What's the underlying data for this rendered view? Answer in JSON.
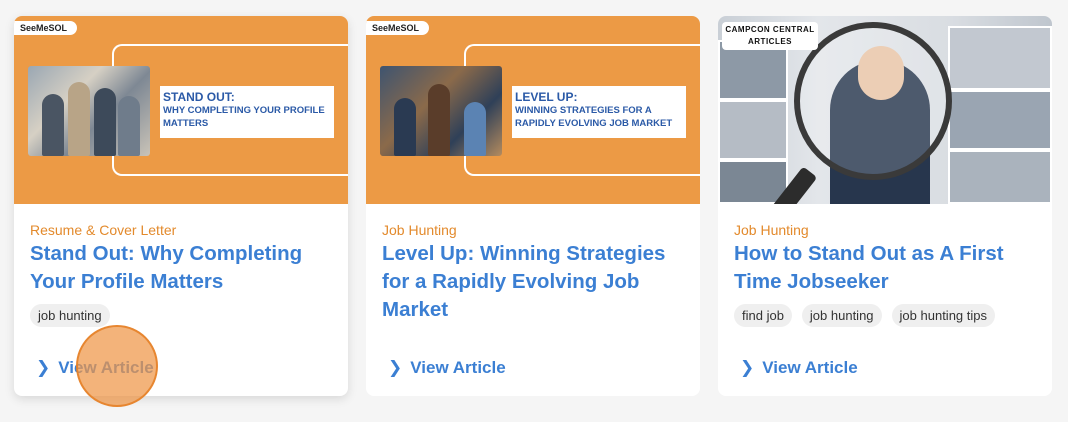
{
  "cards": [
    {
      "brand": "SeeMeSOL",
      "banner_title": "STAND OUT:",
      "banner_sub": "WHY COMPLETING YOUR PROFILE MATTERS",
      "category": "Resume & Cover Letter",
      "title": "Stand Out: Why Completing Your Profile Matters",
      "tags": [
        "job hunting"
      ],
      "link": "View Article"
    },
    {
      "brand": "SeeMeSOL",
      "banner_title": "LEVEL UP:",
      "banner_sub": "WINNING STRATEGIES FOR A RAPIDLY EVOLVING JOB MARKET",
      "category": "Job Hunting",
      "title": "Level Up: Winning Strategies for a Rapidly Evolving Job Market",
      "tags": [],
      "link": "View Article"
    },
    {
      "brand_line1": "CAMPCON CENTRAL",
      "brand_line2": "ARTICLES",
      "category": "Job Hunting",
      "title": "How to Stand Out as A First Time Jobseeker",
      "tags": [
        "find job",
        "job hunting",
        "job hunting tips"
      ],
      "link": "View Article"
    }
  ],
  "icons": {
    "link_chevron": "chevron-right-icon"
  },
  "colors": {
    "accent_orange": "#ec9a45",
    "link_blue": "#3b7fd3",
    "category_orange": "#e38a2c"
  }
}
